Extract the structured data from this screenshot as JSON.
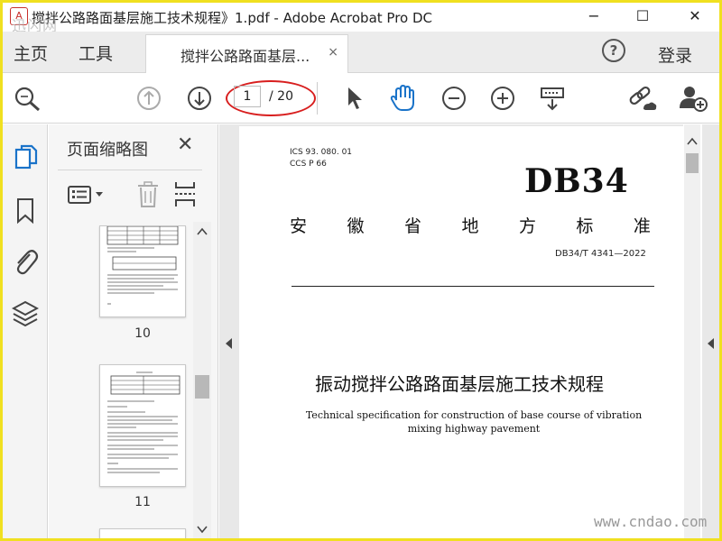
{
  "window": {
    "title": "搅拌公路路面基层施工技术规程》1.pdf - Adobe Acrobat Pro DC",
    "app_icon_glyph": "A",
    "watermark_top": "迅闪网",
    "controls": {
      "minimize": "−",
      "maximize": "☐",
      "close": "✕"
    }
  },
  "menu": {
    "home": "主页",
    "tools": "工具",
    "help": "?",
    "login": "登录"
  },
  "tab": {
    "label": "搅拌公路路面基层...",
    "close": "×"
  },
  "toolbar": {
    "current_page": "1",
    "total_pages": "/ 20",
    "icons": [
      "search-icon",
      "page-up-icon",
      "page-down-icon",
      "select-arrow-icon",
      "hand-icon",
      "zoom-out-icon",
      "zoom-in-icon",
      "scroll-mode-icon",
      "share-link-icon",
      "add-user-icon"
    ]
  },
  "thumbnails": {
    "title": "页面缩略图",
    "close": "✕",
    "pages": [
      {
        "num": "10"
      },
      {
        "num": "11"
      }
    ]
  },
  "document": {
    "ics": "ICS  93. 080. 01",
    "ccs": "CCS  P  66",
    "db_logo": "DB34",
    "province_chars": [
      "安",
      "徽",
      "省",
      "地",
      "方",
      "标",
      "准"
    ],
    "standard_no": "DB34/T  4341—2022",
    "title_cn": "振动搅拌公路路面基层施工技术规程",
    "title_en": "Technical specification for construction of base course of vibration mixing highway pavement"
  },
  "watermark_bottom": "www.cndao.com",
  "colors": {
    "frame": "#f0e020",
    "annotation": "#d81e1e",
    "accent": "#1a73c9"
  }
}
